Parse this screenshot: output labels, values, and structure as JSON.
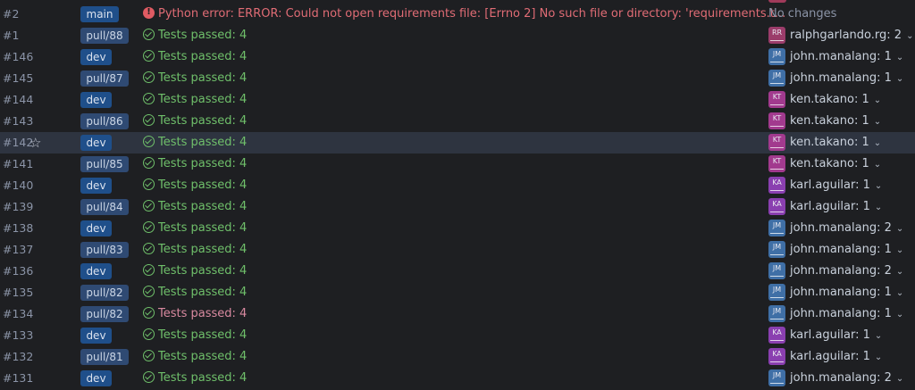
{
  "builds": [
    {
      "num": "#2",
      "branch": "main",
      "branch_kind": "main",
      "status_kind": "err",
      "status": "Python error: ERROR: Could not open requirements file: [Errno 2] No such file or directory: 'requirements.t...",
      "author": "",
      "changes": "No changes",
      "starred": false,
      "selected": false
    },
    {
      "num": "#1",
      "branch": "pull/88",
      "branch_kind": "pull",
      "status_kind": "ok",
      "status": "Tests passed: 4",
      "initials": "RR",
      "av": "rr",
      "author": "ralphgarlando.rg: 2",
      "starred": false,
      "selected": false
    },
    {
      "num": "#146",
      "branch": "dev",
      "branch_kind": "dev",
      "status_kind": "ok",
      "status": "Tests passed: 4",
      "initials": "JM",
      "av": "jm",
      "author": "john.manalang: 1",
      "starred": false,
      "selected": false
    },
    {
      "num": "#145",
      "branch": "pull/87",
      "branch_kind": "pull",
      "status_kind": "ok",
      "status": "Tests passed: 4",
      "initials": "JM",
      "av": "jm",
      "author": "john.manalang: 1",
      "starred": false,
      "selected": false
    },
    {
      "num": "#144",
      "branch": "dev",
      "branch_kind": "dev",
      "status_kind": "ok",
      "status": "Tests passed: 4",
      "initials": "KT",
      "av": "kt",
      "author": "ken.takano: 1",
      "starred": false,
      "selected": false
    },
    {
      "num": "#143",
      "branch": "pull/86",
      "branch_kind": "pull",
      "status_kind": "ok",
      "status": "Tests passed: 4",
      "initials": "KT",
      "av": "kt",
      "author": "ken.takano: 1",
      "starred": false,
      "selected": false
    },
    {
      "num": "#142",
      "branch": "dev",
      "branch_kind": "dev",
      "status_kind": "ok",
      "status": "Tests passed: 4",
      "initials": "KT",
      "av": "kt",
      "author": "ken.takano: 1",
      "starred": true,
      "selected": true
    },
    {
      "num": "#141",
      "branch": "pull/85",
      "branch_kind": "pull",
      "status_kind": "ok",
      "status": "Tests passed: 4",
      "initials": "KT",
      "av": "kt",
      "author": "ken.takano: 1",
      "starred": false,
      "selected": false
    },
    {
      "num": "#140",
      "branch": "dev",
      "branch_kind": "dev",
      "status_kind": "ok",
      "status": "Tests passed: 4",
      "initials": "KA",
      "av": "ka",
      "author": "karl.aguilar: 1",
      "starred": false,
      "selected": false
    },
    {
      "num": "#139",
      "branch": "pull/84",
      "branch_kind": "pull",
      "status_kind": "ok",
      "status": "Tests passed: 4",
      "initials": "KA",
      "av": "ka",
      "author": "karl.aguilar: 1",
      "starred": false,
      "selected": false
    },
    {
      "num": "#138",
      "branch": "dev",
      "branch_kind": "dev",
      "status_kind": "ok",
      "status": "Tests passed: 4",
      "initials": "JM",
      "av": "jm",
      "author": "john.manalang: 2",
      "starred": false,
      "selected": false
    },
    {
      "num": "#137",
      "branch": "pull/83",
      "branch_kind": "pull",
      "status_kind": "ok",
      "status": "Tests passed: 4",
      "initials": "JM",
      "av": "jm",
      "author": "john.manalang: 1",
      "starred": false,
      "selected": false
    },
    {
      "num": "#136",
      "branch": "dev",
      "branch_kind": "dev",
      "status_kind": "ok",
      "status": "Tests passed: 4",
      "initials": "JM",
      "av": "jm",
      "author": "john.manalang: 2",
      "starred": false,
      "selected": false
    },
    {
      "num": "#135",
      "branch": "pull/82",
      "branch_kind": "pull",
      "status_kind": "ok",
      "status": "Tests passed: 4",
      "initials": "JM",
      "av": "jm",
      "author": "john.manalang: 1",
      "starred": false,
      "selected": false
    },
    {
      "num": "#134",
      "branch": "pull/82",
      "branch_kind": "pull",
      "status_kind": "pending",
      "status": "Tests passed: 4",
      "initials": "JM",
      "av": "jm",
      "author": "john.manalang: 1",
      "starred": false,
      "selected": false
    },
    {
      "num": "#133",
      "branch": "dev",
      "branch_kind": "dev",
      "status_kind": "ok",
      "status": "Tests passed: 4",
      "initials": "KA",
      "av": "ka",
      "author": "karl.aguilar: 1",
      "starred": false,
      "selected": false
    },
    {
      "num": "#132",
      "branch": "pull/81",
      "branch_kind": "pull",
      "status_kind": "ok",
      "status": "Tests passed: 4",
      "initials": "KA",
      "av": "ka",
      "author": "karl.aguilar: 1",
      "starred": false,
      "selected": false
    },
    {
      "num": "#131",
      "branch": "dev",
      "branch_kind": "dev",
      "status_kind": "ok",
      "status": "Tests passed: 4",
      "initials": "JM",
      "av": "jm",
      "author": "john.manalang: 2",
      "starred": false,
      "selected": false
    }
  ],
  "colors": {
    "background": "#1e1f22",
    "selected_row": "#2e3440",
    "success": "#6fbf6a",
    "error": "#e06c75",
    "branch_badge": "#1f4f8a"
  },
  "icons": {
    "success": "check-circle-icon",
    "error": "error-circle-icon",
    "star": "star-icon",
    "expand": "chevron-down-icon"
  }
}
